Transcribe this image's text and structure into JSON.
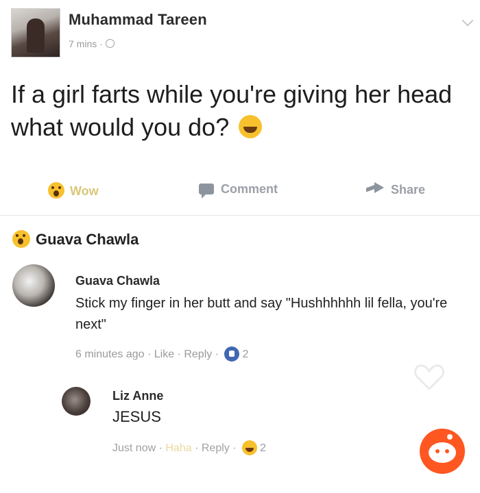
{
  "post": {
    "author": "Muhammad Tareen",
    "time": "7 mins ·",
    "text": "If a girl farts while you're giving her head what would you do?"
  },
  "actions": {
    "wow": "Wow",
    "comment": "Comment",
    "share": "Share"
  },
  "reactor": {
    "name": "Guava Chawla"
  },
  "comments": [
    {
      "name": "Guava Chawla",
      "text": "Stick my finger in her butt and say \"Hushhhhhh lil fella, you're next\"",
      "time": "6 minutes ago",
      "like": "Like",
      "reply": "Reply",
      "reaction_count": "2"
    },
    {
      "name": "Liz Anne",
      "text": "JESUS",
      "time": "Just now",
      "haha": "Haha",
      "reply": "Reply",
      "reaction_count": "2"
    }
  ],
  "colors": {
    "reddit": "#ff5722",
    "like": "#4267b2",
    "emoji": "#f7c12e"
  }
}
